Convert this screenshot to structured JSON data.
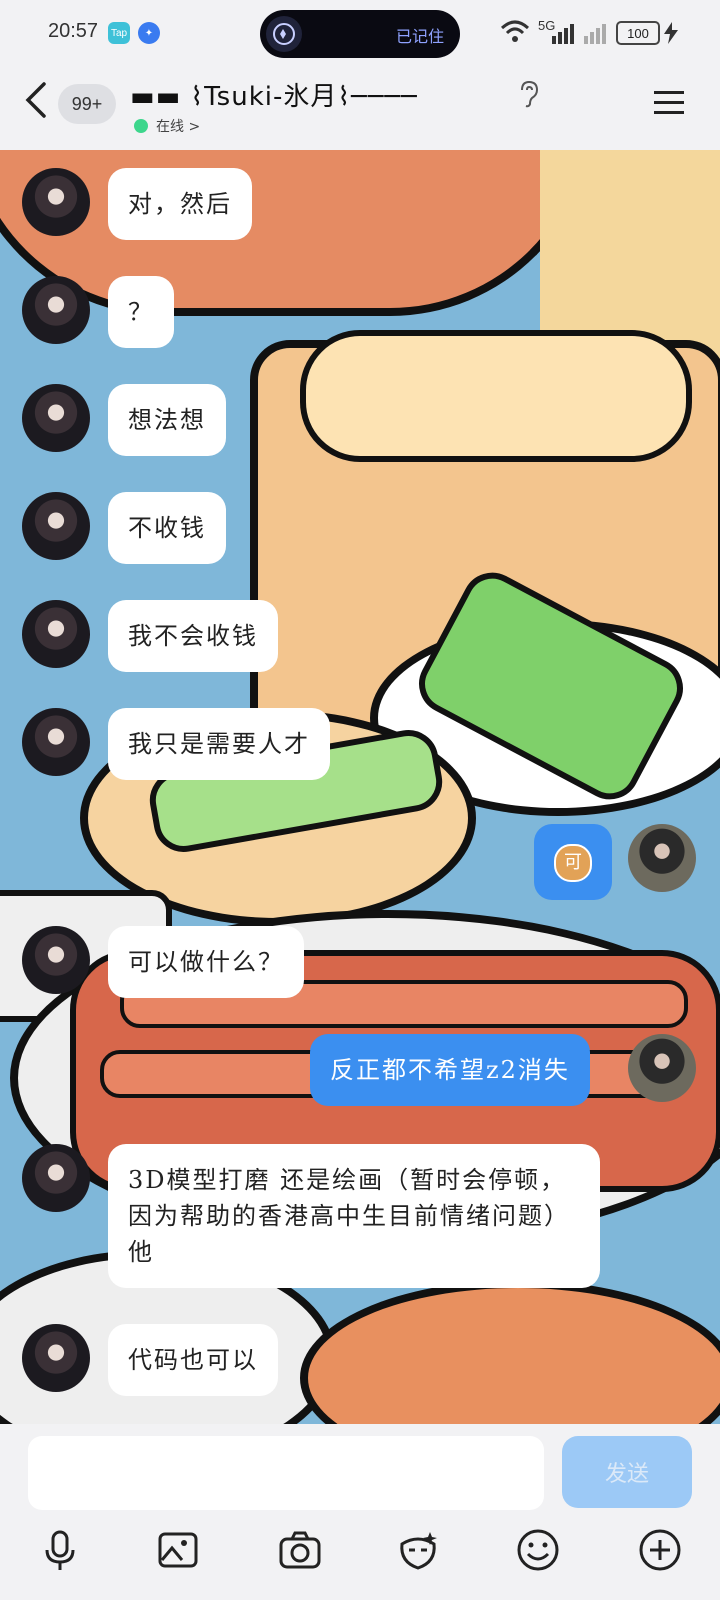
{
  "status_bar": {
    "time": "20:57",
    "app_badges": [
      "Tap",
      "✦"
    ],
    "pill_text": "已记住",
    "signal_label": "5G",
    "battery": "100"
  },
  "header": {
    "unread": "99+",
    "title": "▬▬ ⌇Tsuki-氷月⌇────",
    "status": "在线 >"
  },
  "messages": [
    {
      "side": "in",
      "text": "对，然后"
    },
    {
      "side": "in",
      "text": "？"
    },
    {
      "side": "in",
      "text": "想法想"
    },
    {
      "side": "in",
      "text": "不收钱"
    },
    {
      "side": "in",
      "text": "我不会收钱"
    },
    {
      "side": "in",
      "text": "我只是需要人才"
    },
    {
      "side": "out",
      "text": "可"
    },
    {
      "side": "in",
      "text": "可以做什么？"
    },
    {
      "side": "out",
      "text": "反正都不希望z2消失"
    },
    {
      "side": "in",
      "text": "3D模型打磨 还是绘画（暂时会停顿，因为帮助的香港高中生目前情绪问题）他"
    },
    {
      "side": "in",
      "text": "代码也可以"
    }
  ],
  "composer": {
    "placeholder": "",
    "send_label": "发送"
  },
  "toolbar": [
    "microphone-icon",
    "image-icon",
    "camera-icon",
    "sticker-icon",
    "emoji-icon",
    "plus-icon"
  ],
  "colors": {
    "outgoing_bubble": "#3b8ff0",
    "send_button": "#9cc9f6",
    "online_dot": "#3dd68c"
  }
}
